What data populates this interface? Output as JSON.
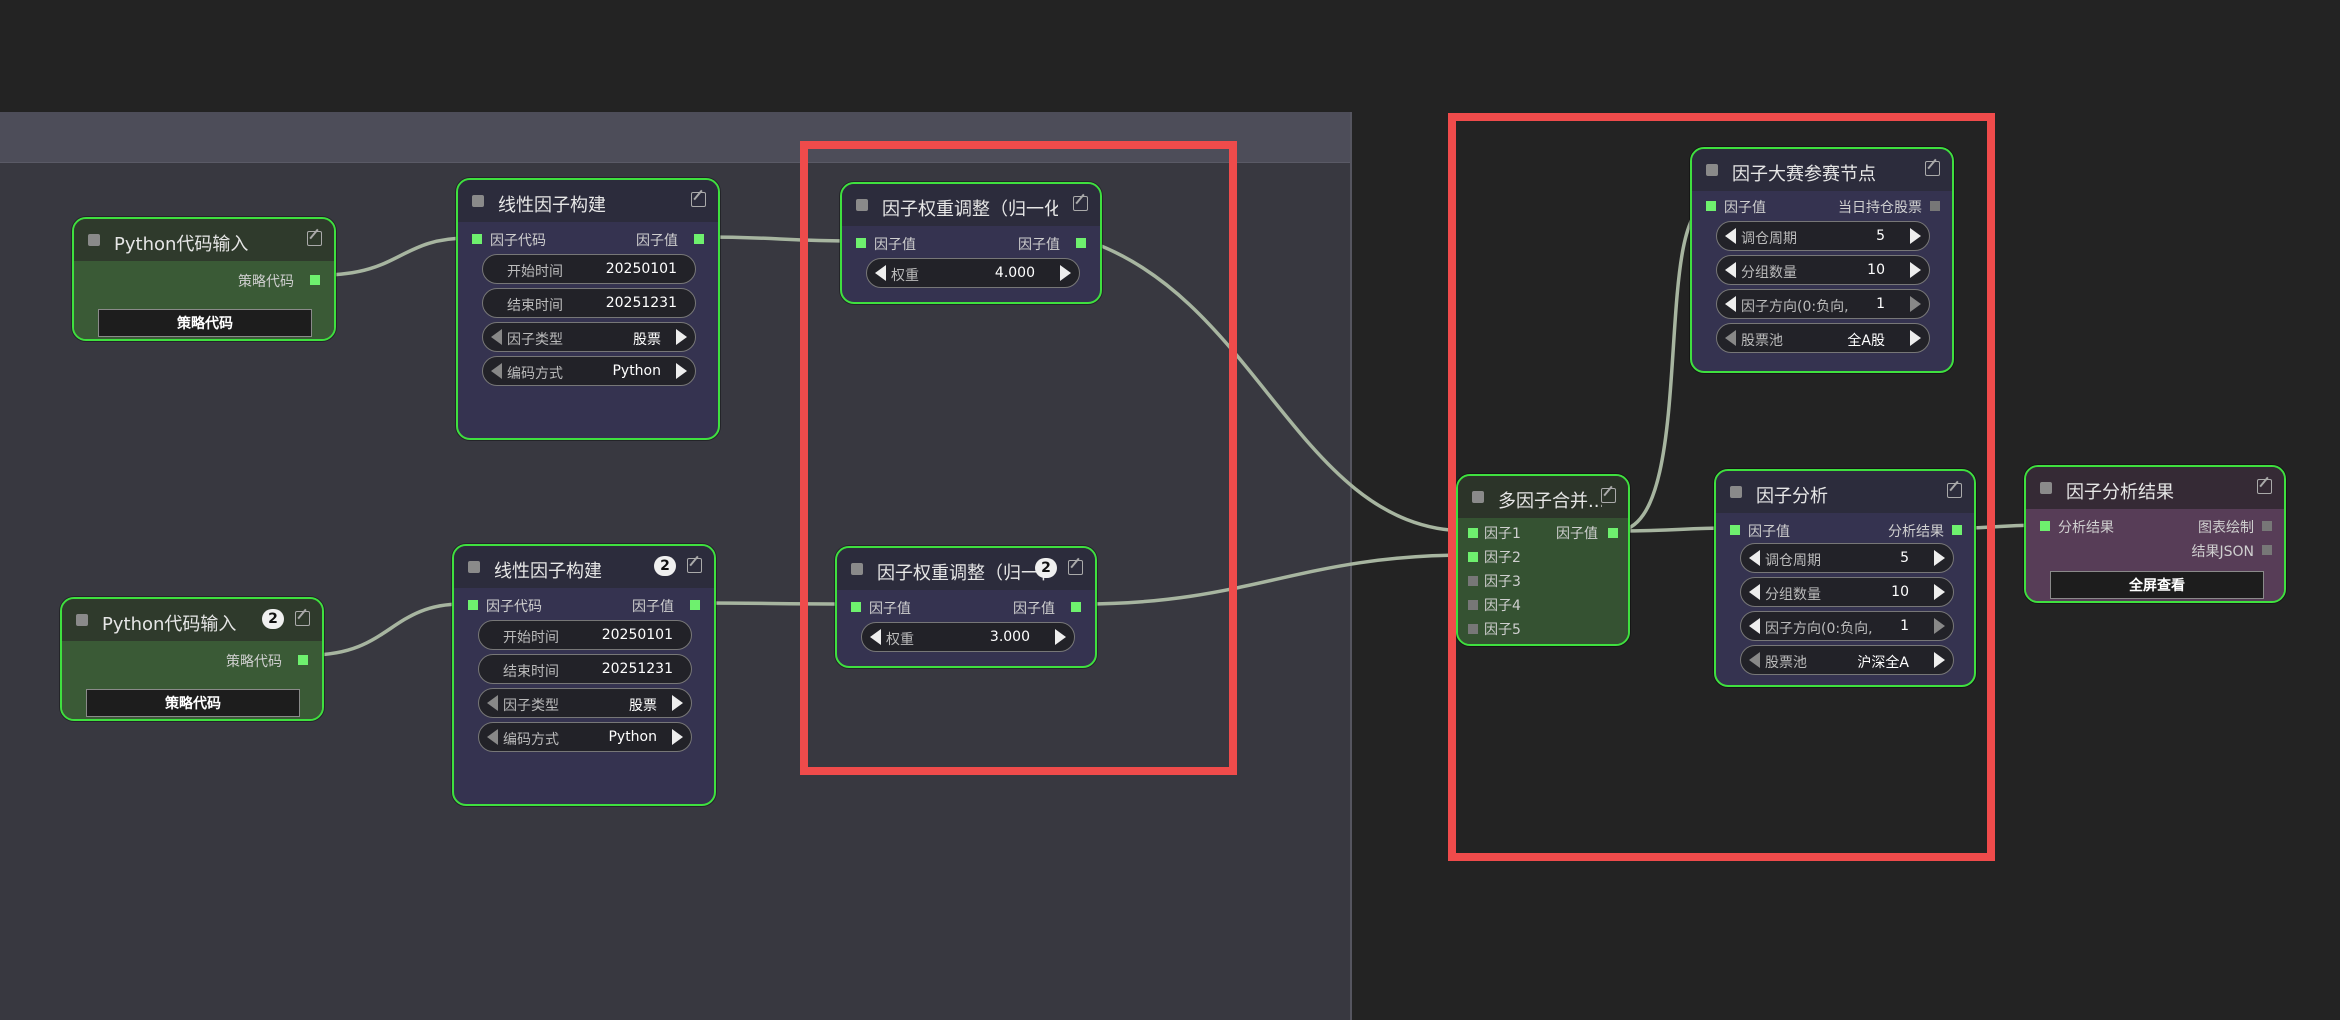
{
  "colors": {
    "canvas": "#232323",
    "group": "#383840",
    "node_border": "#3fe03f",
    "highlight": "#ef4b4b",
    "link": "#a7b5a0"
  },
  "nodes": {
    "py1": {
      "title": "Python代码输入",
      "out": "策略代码",
      "button": "策略代码"
    },
    "py2": {
      "title": "Python代码输入",
      "badge": "2",
      "out": "策略代码",
      "button": "策略代码"
    },
    "lin1": {
      "title": "线性因子构建",
      "in": "因子代码",
      "out": "因子值",
      "w": [
        {
          "label": "开始时间",
          "value": "20250101"
        },
        {
          "label": "结束时间",
          "value": "20251231"
        },
        {
          "label": "因子类型",
          "value": "股票"
        },
        {
          "label": "编码方式",
          "value": "Python"
        }
      ]
    },
    "lin2": {
      "title": "线性因子构建",
      "badge": "2",
      "in": "因子代码",
      "out": "因子值",
      "w": [
        {
          "label": "开始时间",
          "value": "20250101"
        },
        {
          "label": "结束时间",
          "value": "20251231"
        },
        {
          "label": "因子类型",
          "value": "股票"
        },
        {
          "label": "编码方式",
          "value": "Python"
        }
      ]
    },
    "wt1": {
      "title": "因子权重调整（归一化",
      "in": "因子值",
      "out": "因子值",
      "w": {
        "label": "权重",
        "value": "4.000"
      }
    },
    "wt2": {
      "title": "因子权重调整（归一化",
      "badge": "2",
      "in": "因子值",
      "out": "因子值",
      "w": {
        "label": "权重",
        "value": "3.000"
      }
    },
    "merge": {
      "title": "多因子合并...",
      "ins": [
        "因子1",
        "因子2",
        "因子3",
        "因子4",
        "因子5"
      ],
      "out": "因子值"
    },
    "contest": {
      "title": "因子大赛参赛节点",
      "in": "因子值",
      "out": "当日持仓股票",
      "w": [
        {
          "label": "调仓周期",
          "value": "5"
        },
        {
          "label": "分组数量",
          "value": "10"
        },
        {
          "label": "因子方向(0:负向,",
          "value": "1"
        },
        {
          "label": "股票池",
          "value": "全A股"
        }
      ]
    },
    "analysis": {
      "title": "因子分析",
      "in": "因子值",
      "out": "分析结果",
      "w": [
        {
          "label": "调仓周期",
          "value": "5"
        },
        {
          "label": "分组数量",
          "value": "10"
        },
        {
          "label": "因子方向(0:负向,",
          "value": "1"
        },
        {
          "label": "股票池",
          "value": "沪深全A"
        }
      ]
    },
    "result": {
      "title": "因子分析结果",
      "in": "分析结果",
      "outs": [
        "图表绘制",
        "结果JSON"
      ],
      "button": "全屏查看"
    }
  }
}
